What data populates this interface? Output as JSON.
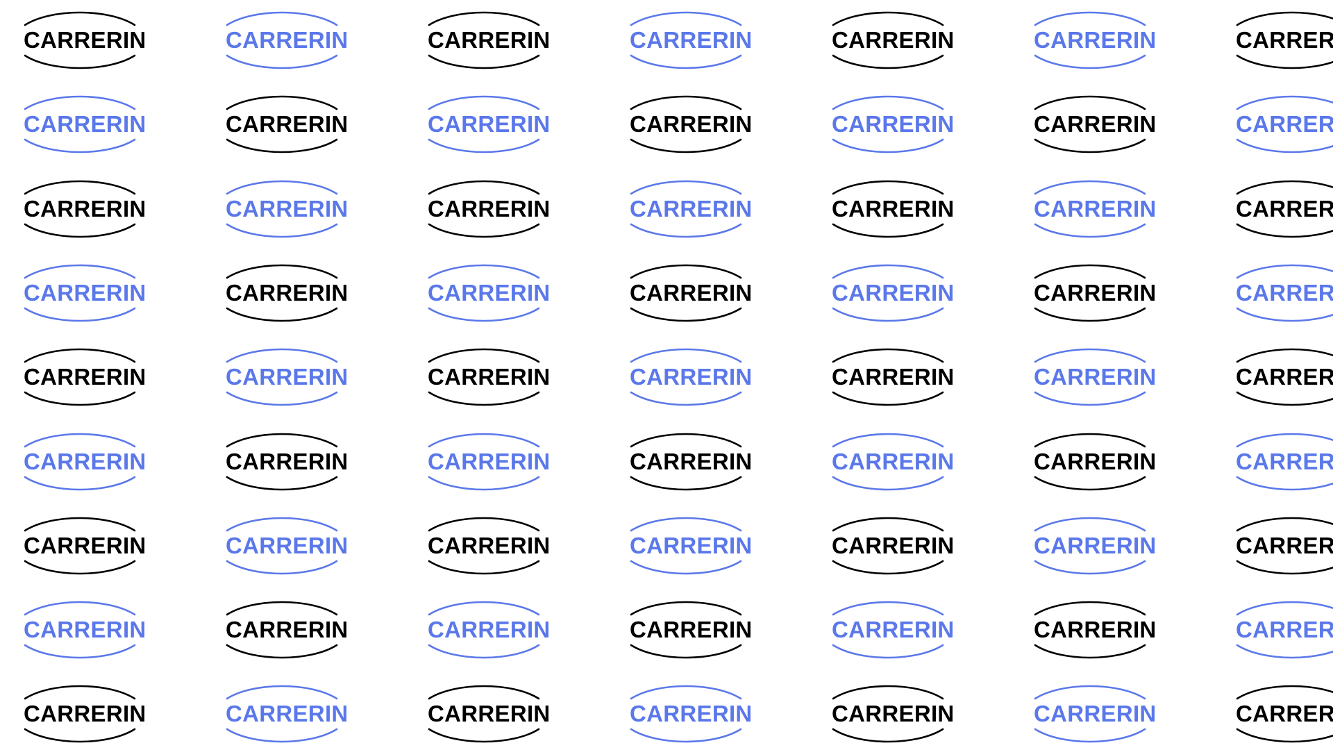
{
  "brand": {
    "wordmark": "CARRERIN"
  },
  "colors": {
    "background": "#ffffff",
    "primary": "#000000",
    "accent": "#5b78ea"
  },
  "pattern": {
    "rows": 9,
    "columns": 7,
    "color_sequence": "alternating checkerboard, top-left logo black"
  }
}
